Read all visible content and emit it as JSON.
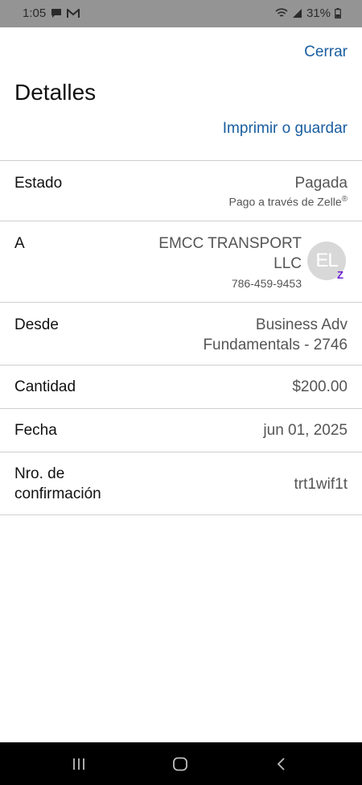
{
  "status_bar": {
    "time": "1:05",
    "battery": "31%",
    "icons": [
      "chat-bubble-icon",
      "gmail-icon",
      "wifi-icon",
      "signal-icon",
      "battery-icon"
    ]
  },
  "header": {
    "close_label": "Cerrar",
    "title": "Detalles",
    "print_label": "Imprimir o guardar"
  },
  "details": {
    "estado": {
      "label": "Estado",
      "value": "Pagada",
      "sub": "Pago a través de Zelle",
      "sub_mark": "®"
    },
    "a": {
      "label": "A",
      "name_line1": "EMCC TRANSPORT",
      "name_line2": "LLC",
      "phone": "786-459-9453",
      "avatar_initials": "EL",
      "badge": "Z"
    },
    "desde": {
      "label": "Desde",
      "value_line1": "Business Adv",
      "value_line2": "Fundamentals - 2746"
    },
    "cantidad": {
      "label": "Cantidad",
      "value": "$200.00"
    },
    "fecha": {
      "label": "Fecha",
      "value": "jun 01, 2025"
    },
    "confirmacion": {
      "label_line1": "Nro. de",
      "label_line2": "confirmación",
      "value": "trt1wif1t"
    }
  },
  "colors": {
    "link": "#1a5ea0",
    "zelle": "#6d1ed4",
    "status_bar": "#949494"
  },
  "nav": {
    "icons": [
      "recents-icon",
      "home-icon",
      "back-icon"
    ]
  }
}
